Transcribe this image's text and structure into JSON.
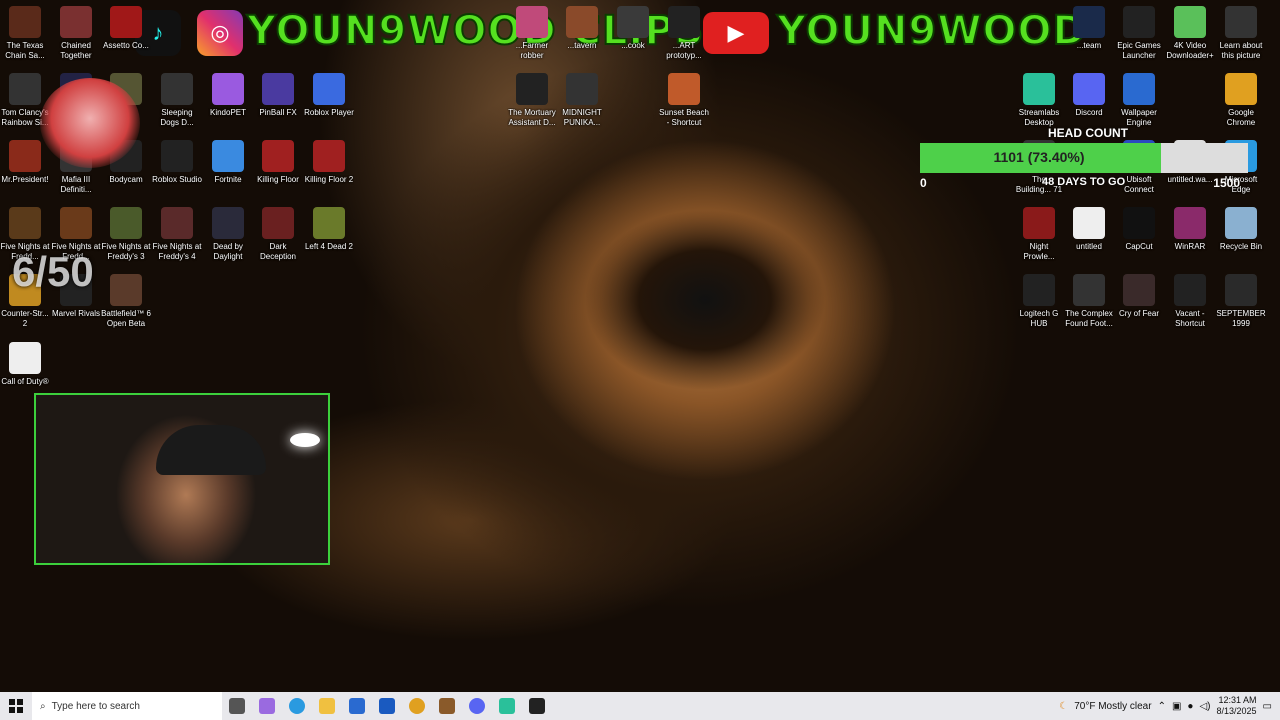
{
  "banner": {
    "left_text": "YOUN9WOOD CLIPS",
    "right_text": "YOUN9WOOD"
  },
  "desktop_icons_left": [
    {
      "label": "The Texas Chain Sa...",
      "color": "#5a2a1a"
    },
    {
      "label": "Chained Together",
      "color": "#7a3030"
    },
    {
      "label": "Assetto Co...",
      "color": "#a01818"
    },
    {
      "label": "Tom Clancy's Rainbow Si...",
      "color": "#333"
    },
    {
      "label": "...",
      "color": "#224"
    },
    {
      "label": "...",
      "color": "#553"
    },
    {
      "label": "Sleeping Dogs D...",
      "color": "#333"
    },
    {
      "label": "KindoPET",
      "color": "#9a5ae0"
    },
    {
      "label": "PinBall FX",
      "color": "#4a3aa0"
    },
    {
      "label": "Roblox Player",
      "color": "#3a6ae0"
    },
    {
      "label": "Mr.President!",
      "color": "#8a2a1a"
    },
    {
      "label": "Mafia III Definiti...",
      "color": "#333"
    },
    {
      "label": "Bodycam",
      "color": "#222"
    },
    {
      "label": "Roblox Studio",
      "color": "#222"
    },
    {
      "label": "Fortnite",
      "color": "#3a8ae0"
    },
    {
      "label": "Killing Floor",
      "color": "#a02020"
    },
    {
      "label": "Killing Floor 2",
      "color": "#a02020"
    },
    {
      "label": "Five Nights at Fredd...",
      "color": "#5a3a1a"
    },
    {
      "label": "Five Nights at Fredd...",
      "color": "#6a3a1a"
    },
    {
      "label": "Five Nights at Freddy's 3",
      "color": "#4a5a2a"
    },
    {
      "label": "Five Nights at Freddy's 4",
      "color": "#5a2a2a"
    },
    {
      "label": "Dead by Daylight",
      "color": "#2a2a3a"
    },
    {
      "label": "Dark Deception",
      "color": "#6a2020"
    },
    {
      "label": "Left 4 Dead 2",
      "color": "#6a7a2a"
    },
    {
      "label": "Counter-Str... 2",
      "color": "#c08a20"
    },
    {
      "label": "Marvel Rivals",
      "color": "#222"
    },
    {
      "label": "Battlefield™ 6 Open Beta",
      "color": "#5a3a2a"
    },
    {
      "label": "Call of Duty®",
      "color": "#eee"
    }
  ],
  "desktop_icons_top_middle": [
    {
      "label": "...Farmer robber",
      "color": "#c04a7a"
    },
    {
      "label": "...tavern",
      "color": "#8a4a2a"
    },
    {
      "label": "...cook",
      "color": "#3a3a3a"
    },
    {
      "label": "...ART prototyp...",
      "color": "#222"
    },
    {
      "label": "The Mortuary Assistant D...",
      "color": "#222"
    },
    {
      "label": "MIDNIGHT PUNIKA...",
      "color": "#333"
    },
    {
      "label": "Sunset Beach - Shortcut",
      "color": "#c05a2a"
    }
  ],
  "desktop_icons_right": [
    {
      "label": "...team",
      "color": "#1a2a4a"
    },
    {
      "label": "Epic Games Launcher",
      "color": "#222"
    },
    {
      "label": "4K Video Downloader+",
      "color": "#5ac05a"
    },
    {
      "label": "Learn about this picture",
      "color": "#333"
    },
    {
      "label": "Streamlabs Desktop",
      "color": "#2ac09a"
    },
    {
      "label": "Discord",
      "color": "#5865f2"
    },
    {
      "label": "Wallpaper Engine",
      "color": "#2a6ad0"
    },
    {
      "label": "Google Chrome",
      "color": "#e0a020"
    },
    {
      "label": "The Building... 71 Inciden...",
      "color": "#333"
    },
    {
      "label": "Ubisoft Connect",
      "color": "#2a4ac0"
    },
    {
      "label": "untitled.wa...",
      "color": "#ddd"
    },
    {
      "label": "Microsoft Edge",
      "color": "#2a9ae0"
    },
    {
      "label": "Night Prowle...",
      "color": "#8a1a1a"
    },
    {
      "label": "untitled",
      "color": "#eee"
    },
    {
      "label": "CapCut",
      "color": "#111"
    },
    {
      "label": "WinRAR",
      "color": "#8a2a6a"
    },
    {
      "label": "Recycle Bin",
      "color": "#8ab0d0"
    },
    {
      "label": "Logitech G HUB",
      "color": "#222"
    },
    {
      "label": "The Complex Found Foot...",
      "color": "#333"
    },
    {
      "label": "Cry of Fear",
      "color": "#3a2a2a"
    },
    {
      "label": "Vacant - Shortcut",
      "color": "#222"
    },
    {
      "label": "SEPTEMBER 1999",
      "color": "#2a2a2a"
    }
  ],
  "headcount": {
    "title": "HEAD COUNT",
    "value_text": "1101 (73.40%)",
    "progress": 0.734,
    "min": "0",
    "max": "1500",
    "days_text": "48 DAYS TO GO"
  },
  "overlay": {
    "counter": "6/50"
  },
  "taskbar": {
    "search_placeholder": "Type here to search",
    "weather": "70°F  Mostly clear",
    "time": "12:31 AM",
    "date": "8/13/2025"
  }
}
